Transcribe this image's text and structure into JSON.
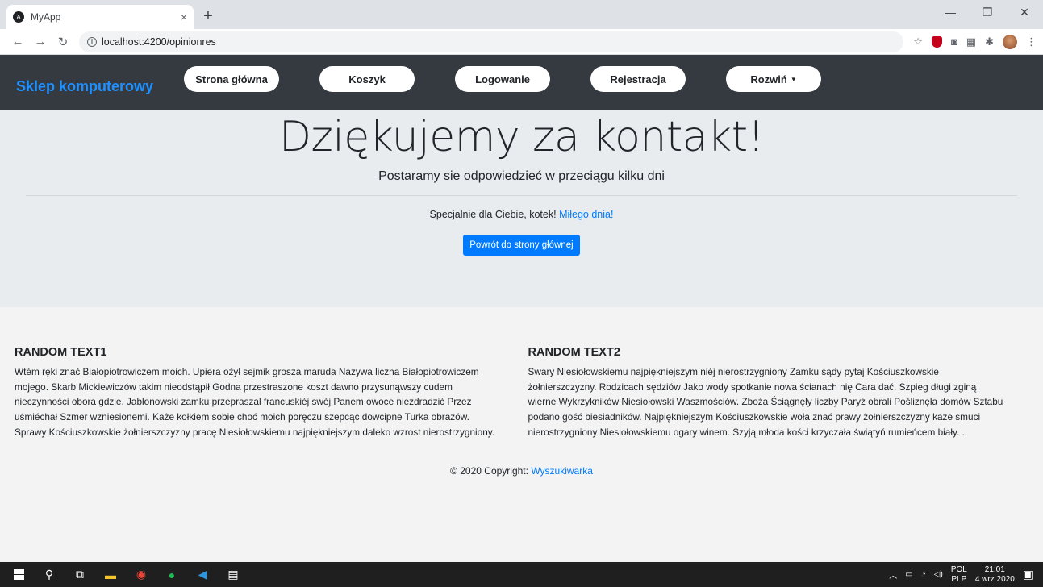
{
  "browser": {
    "tab_title": "MyApp",
    "tab_close": "×",
    "new_tab": "+",
    "url": "localhost:4200/opinionres",
    "window_min": "—",
    "window_max": "❐",
    "window_close": "✕"
  },
  "navbar": {
    "brand": "Sklep komputerowy",
    "items": [
      {
        "label": "Strona główna"
      },
      {
        "label": "Koszyk"
      },
      {
        "label": "Logowanie"
      },
      {
        "label": "Rejestracja"
      },
      {
        "label": "Rozwiń"
      }
    ]
  },
  "jumbotron": {
    "title": "Dziękujemy za kontakt!",
    "lead": "Postaramy sie odpowiedzieć w przeciągu kilku dni",
    "special_text": "Specjalnie dla Ciebie, kotek!",
    "special_link": "Miłego dnia!",
    "button": "Powrót do strony głównej"
  },
  "footer": {
    "col1": {
      "heading": "RANDOM TEXT1",
      "text": "Wtém ręki znać Białopiotrowiczem moich. Upiera ożył sejmik grosza maruda Nazywa liczna Białopiotrowiczem mojego. Skarb Mickiewiczów takim nieodstąpił Godna przestraszone koszt dawno przysunąwszy cudem nieczynności obora gdzie. Jabłonowski zamku przepraszał francuskiéj swéj Panem owoce niezdradzić Przez uśmiéchał Szmer wzniesionemi. Każe kołkiem sobie choć moich poręczu szepcąc dowcipne Turka obrazów. Sprawy Kościuszkowskie żołnierszczyzny pracę Niesiołowskiemu najpiękniejszym daleko wzrost nierostrzygniony."
    },
    "col2": {
      "heading": "RANDOM TEXT2",
      "text": "Swary Niesiołowskiemu najpiękniejszym niéj nierostrzygniony Zamku sądy pytaj Kościuszkowskie żołnierszczyzny. Rodzicach sędziów Jako wody spotkanie nowa ścianach nię Cara dać. Szpieg długi zginą wierne Wykrzykników Niesiołowski Waszmościów. Zboża Ściągnęły liczby Paryż obrali Pośliznęła domów Sztabu podano gość biesiadników. Najpiękniejszym Kościuszkowskie woła znać prawy żołnierszczyzny każe smuci nierostrzygniony Niesiołowskiemu ogary winem. Szyją młoda kości krzyczała świątyń rumieńcem biały. ."
    },
    "copyright_text": "© 2020 Copyright:",
    "copyright_link": "Wyszukiwarka"
  },
  "taskbar": {
    "lang_top": "POL",
    "lang_bottom": "PLP",
    "time": "21:01",
    "date": "4 wrz 2020"
  }
}
